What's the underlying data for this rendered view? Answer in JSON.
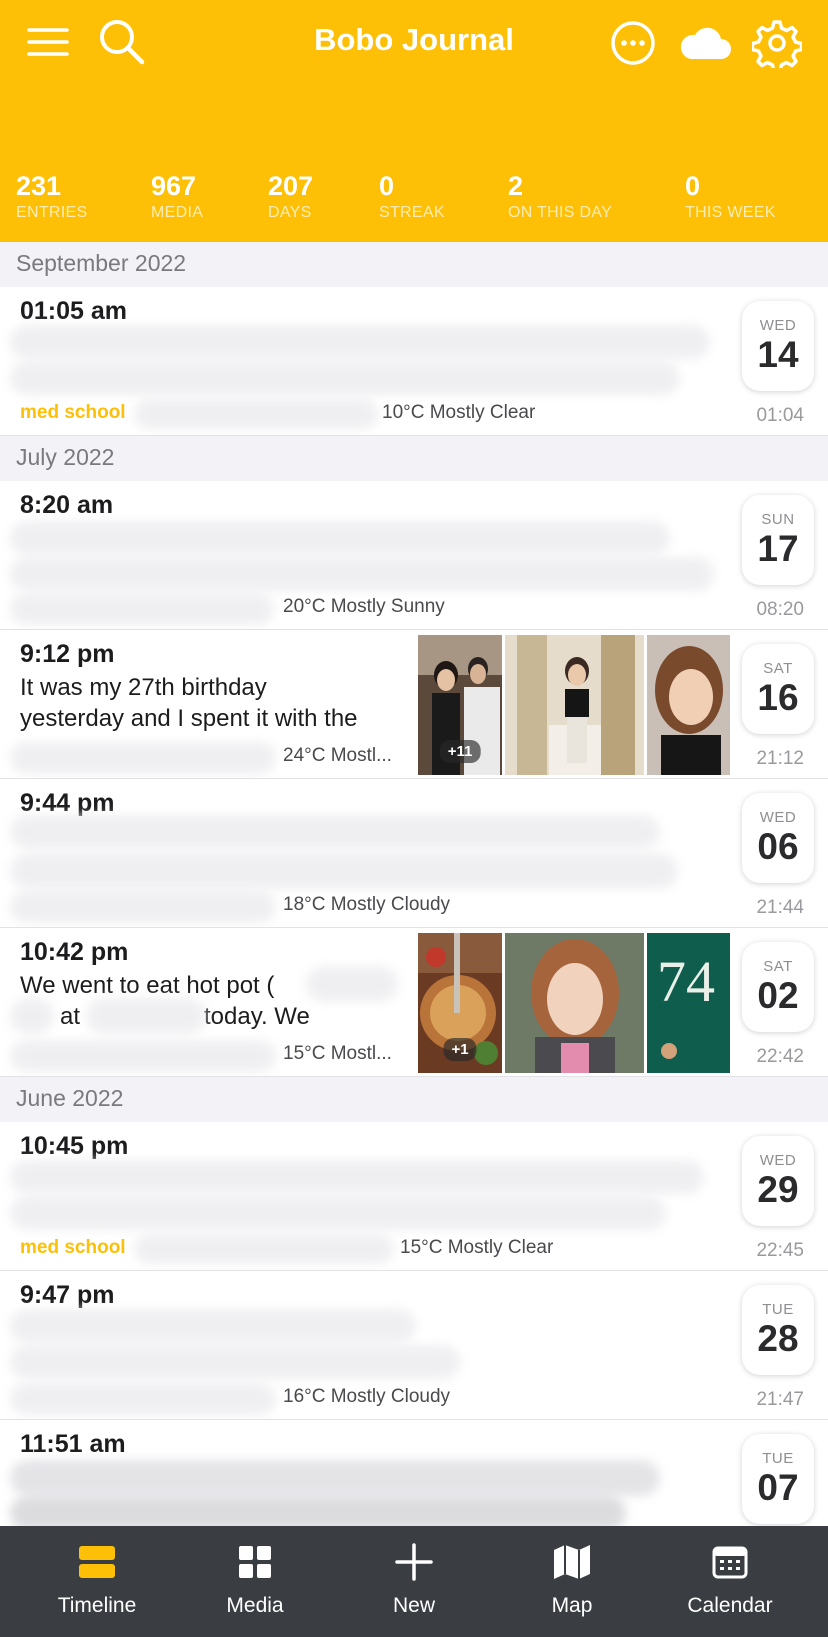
{
  "app": {
    "title": "Bobo Journal"
  },
  "header_icons": [
    "menu-icon",
    "search-icon",
    "more-icon",
    "cloud-icon",
    "gear-icon"
  ],
  "colors": {
    "accent": "#fdc006",
    "tabbar": "#3a3d42"
  },
  "stats": [
    {
      "value": "231",
      "label": "ENTRIES"
    },
    {
      "value": "967",
      "label": "MEDIA"
    },
    {
      "value": "207",
      "label": "DAYS"
    },
    {
      "value": "0",
      "label": "STREAK"
    },
    {
      "value": "2",
      "label": "ON THIS DAY"
    },
    {
      "value": "0",
      "label": "THIS WEEK"
    }
  ],
  "sections": [
    "September 2022",
    "July 2022",
    "June 2022"
  ],
  "entries": [
    {
      "time": "01:05 am",
      "tag": "med school",
      "weather": "10°C Mostly Clear",
      "dow": "WED",
      "day": "14",
      "clock": "01:04"
    },
    {
      "time": "8:20 am",
      "weather": "20°C Mostly Sunny",
      "dow": "SUN",
      "day": "17",
      "clock": "08:20"
    },
    {
      "time": "9:12 pm",
      "text_line1": "It was my 27th birthday",
      "text_line2": "yesterday and I spent it with the",
      "weather": "24°C Mostl...",
      "badge": "+11",
      "dow": "SAT",
      "day": "16",
      "clock": "21:12"
    },
    {
      "time": "9:44 pm",
      "weather": "18°C Mostly Cloudy",
      "dow": "WED",
      "day": "06",
      "clock": "21:44"
    },
    {
      "time": "10:42 pm",
      "text_a": "We went to eat hot pot (",
      "text_b": "at",
      "text_c": "today. We",
      "weather": "15°C Mostl...",
      "badge": "+1",
      "dow": "SAT",
      "day": "02",
      "clock": "22:42"
    },
    {
      "time": "10:45 pm",
      "tag": "med school",
      "weather": "15°C Mostly Clear",
      "dow": "WED",
      "day": "29",
      "clock": "22:45"
    },
    {
      "time": "9:47 pm",
      "weather": "16°C Mostly Cloudy",
      "dow": "TUE",
      "day": "28",
      "clock": "21:47"
    },
    {
      "time": "11:51 am",
      "dow": "TUE",
      "day": "07"
    }
  ],
  "tabs": [
    {
      "label": "Timeline",
      "icon": "timeline-icon",
      "active": true
    },
    {
      "label": "Media",
      "icon": "grid-icon"
    },
    {
      "label": "New",
      "icon": "plus-icon"
    },
    {
      "label": "Map",
      "icon": "map-icon"
    },
    {
      "label": "Calendar",
      "icon": "calendar-icon"
    }
  ]
}
